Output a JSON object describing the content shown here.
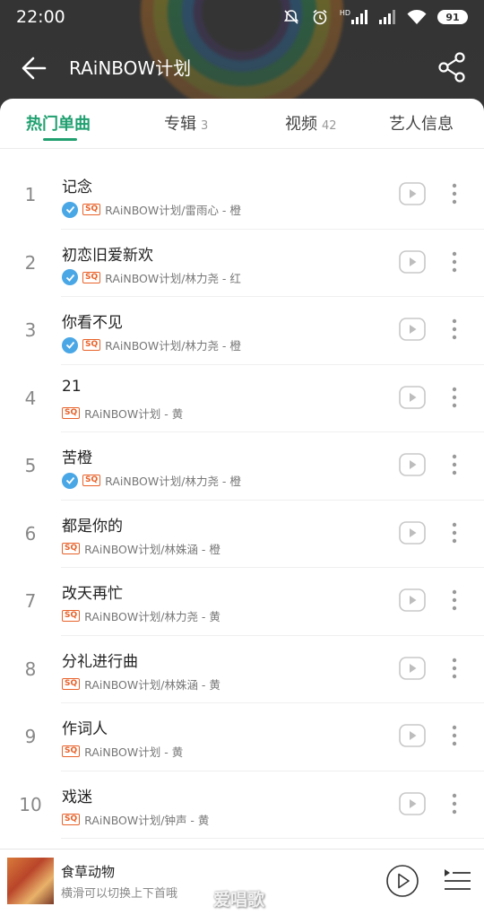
{
  "status_bar": {
    "time": "22:00",
    "network_label": "HD",
    "battery": "91"
  },
  "header": {
    "title": "RAiNBOW计划"
  },
  "tabs": [
    {
      "label": "热门单曲",
      "count": ""
    },
    {
      "label": "专辑",
      "count": "3"
    },
    {
      "label": "视频",
      "count": "42"
    },
    {
      "label": "艺人信息",
      "count": ""
    }
  ],
  "songs": [
    {
      "num": "1",
      "title": "记念",
      "verified": true,
      "quality": "SQ",
      "sub": "RAiNBOW计划/雷雨心 - 橙"
    },
    {
      "num": "2",
      "title": "初恋旧爱新欢",
      "verified": true,
      "quality": "SQ",
      "sub": "RAiNBOW计划/林力尧 - 红"
    },
    {
      "num": "3",
      "title": "你看不见",
      "verified": true,
      "quality": "SQ",
      "sub": "RAiNBOW计划/林力尧 - 橙"
    },
    {
      "num": "4",
      "title": "21",
      "verified": false,
      "quality": "SQ",
      "sub": "RAiNBOW计划 - 黄"
    },
    {
      "num": "5",
      "title": "苦橙",
      "verified": true,
      "quality": "SQ",
      "sub": "RAiNBOW计划/林力尧 - 橙"
    },
    {
      "num": "6",
      "title": "都是你的",
      "verified": false,
      "quality": "SQ",
      "sub": "RAiNBOW计划/林姝涵 - 橙"
    },
    {
      "num": "7",
      "title": "改天再忙",
      "verified": false,
      "quality": "SQ",
      "sub": "RAiNBOW计划/林力尧 - 黄"
    },
    {
      "num": "8",
      "title": "分礼进行曲",
      "verified": false,
      "quality": "SQ",
      "sub": "RAiNBOW计划/林姝涵 - 黄"
    },
    {
      "num": "9",
      "title": "作词人",
      "verified": false,
      "quality": "SQ",
      "sub": "RAiNBOW计划 - 黄"
    },
    {
      "num": "10",
      "title": "戏迷",
      "verified": false,
      "quality": "SQ",
      "sub": "RAiNBOW计划/钟声 - 黄"
    }
  ],
  "now_playing": {
    "title": "食草动物",
    "subtitle": "横滑可以切换上下首哦"
  },
  "watermark": "爱唱歌",
  "colors": {
    "accent": "#20a070",
    "sq_badge": "#e8622a",
    "verified": "#4aa7e6"
  }
}
